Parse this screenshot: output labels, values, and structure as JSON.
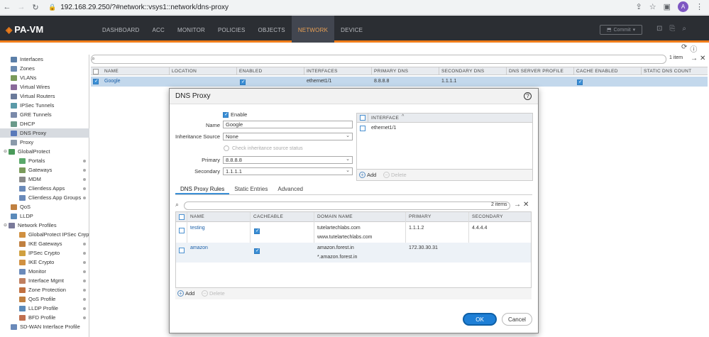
{
  "browser": {
    "url": "192.168.29.250/?#network::vsys1::network/dns-proxy",
    "avatar_letter": "A"
  },
  "app": {
    "logo": "PA-VM",
    "tabs": [
      "DASHBOARD",
      "ACC",
      "MONITOR",
      "POLICIES",
      "OBJECTS",
      "NETWORK",
      "DEVICE"
    ],
    "active_tab": "NETWORK",
    "commit_label": "Commit"
  },
  "sidebar": {
    "items": [
      {
        "label": "Interfaces",
        "indent": 0,
        "color": "#5b7fa8"
      },
      {
        "label": "Zones",
        "indent": 0,
        "color": "#6a8ab0"
      },
      {
        "label": "VLANs",
        "indent": 0,
        "color": "#7a9a5a"
      },
      {
        "label": "Virtual Wires",
        "indent": 0,
        "color": "#8a6a9a"
      },
      {
        "label": "Virtual Routers",
        "indent": 0,
        "color": "#6a7a9a"
      },
      {
        "label": "IPSec Tunnels",
        "indent": 0,
        "color": "#5a9aa8"
      },
      {
        "label": "GRE Tunnels",
        "indent": 0,
        "color": "#7a8aaa"
      },
      {
        "label": "DHCP",
        "indent": 0,
        "color": "#6a9a8a"
      },
      {
        "label": "DNS Proxy",
        "indent": 0,
        "color": "#5a7aba",
        "active": true
      },
      {
        "label": "Proxy",
        "indent": 0,
        "color": "#8a9aaa"
      },
      {
        "label": "GlobalProtect",
        "indent": 0,
        "color": "#4a9a5a",
        "toggle": true
      },
      {
        "label": "Portals",
        "indent": 1,
        "color": "#5aa86a"
      },
      {
        "label": "Gateways",
        "indent": 1,
        "color": "#7a9a5a"
      },
      {
        "label": "MDM",
        "indent": 1,
        "color": "#8a8a8a"
      },
      {
        "label": "Clientless Apps",
        "indent": 1,
        "color": "#6a8aba"
      },
      {
        "label": "Clientless App Groups",
        "indent": 1,
        "color": "#6a8aba"
      },
      {
        "label": "QoS",
        "indent": 0,
        "color": "#c08040"
      },
      {
        "label": "LLDP",
        "indent": 0,
        "color": "#5a8aba"
      },
      {
        "label": "Network Profiles",
        "indent": 0,
        "color": "#7a7a9a",
        "toggle": true
      },
      {
        "label": "GlobalProtect IPSec Crypto",
        "indent": 1,
        "color": "#d09040"
      },
      {
        "label": "IKE Gateways",
        "indent": 1,
        "color": "#c08040"
      },
      {
        "label": "IPSec Crypto",
        "indent": 1,
        "color": "#d0a040"
      },
      {
        "label": "IKE Crypto",
        "indent": 1,
        "color": "#d09040"
      },
      {
        "label": "Monitor",
        "indent": 1,
        "color": "#6a8aba"
      },
      {
        "label": "Interface Mgmt",
        "indent": 1,
        "color": "#c08060"
      },
      {
        "label": "Zone Protection",
        "indent": 1,
        "color": "#c07040"
      },
      {
        "label": "QoS Profile",
        "indent": 1,
        "color": "#c08040"
      },
      {
        "label": "LLDP Profile",
        "indent": 1,
        "color": "#5a8aba"
      },
      {
        "label": "BFD Profile",
        "indent": 1,
        "color": "#c07050"
      },
      {
        "label": "SD-WAN Interface Profile",
        "indent": 0,
        "color": "#6a8aba"
      }
    ]
  },
  "grid": {
    "count": "1 item",
    "columns": [
      "NAME",
      "LOCATION",
      "ENABLED",
      "INTERFACES",
      "PRIMARY DNS",
      "SECONDARY DNS",
      "DNS SERVER PROFILE",
      "CACHE ENABLED",
      "STATIC DNS COUNT"
    ],
    "row": {
      "name": "Google",
      "interfaces": "ethernet1/1",
      "primary": "8.8.8.8",
      "secondary": "1.1.1.1"
    }
  },
  "modal": {
    "title": "DNS Proxy",
    "enable_label": "Enable",
    "name_label": "Name",
    "name_value": "Google",
    "inherit_label": "Inheritance Source",
    "inherit_value": "None",
    "check_inherit": "Check inheritance source status",
    "primary_label": "Primary",
    "primary_value": "8.8.8.8",
    "secondary_label": "Secondary",
    "secondary_value": "1.1.1.1",
    "iface_header": "INTERFACE",
    "iface_rows": [
      "ethernet1/1"
    ],
    "add_label": "Add",
    "delete_label": "Delete",
    "tabs": [
      "DNS Proxy Rules",
      "Static Entries",
      "Advanced"
    ],
    "rules_count": "2 items",
    "rules_columns": [
      "NAME",
      "CACHEABLE",
      "DOMAIN NAME",
      "PRIMARY",
      "SECONDARY"
    ],
    "rules": [
      {
        "name": "testing",
        "domain1": "tutelartechlabs.com",
        "domain2": "www.tutelartechlabs.com",
        "primary": "1.1.1.2",
        "secondary": "4.4.4.4"
      },
      {
        "name": "amazon",
        "domain1": "amazon.forest.in",
        "domain2": "*.amazon.forest.in",
        "primary": "172.30.30.31",
        "secondary": ""
      }
    ],
    "ok_label": "OK",
    "cancel_label": "Cancel"
  }
}
